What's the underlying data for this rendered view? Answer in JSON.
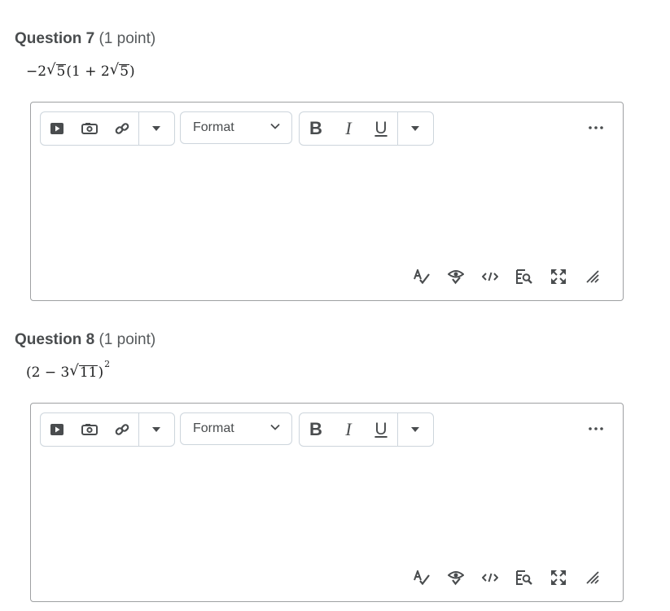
{
  "questions": [
    {
      "number_label": "Question 7",
      "points_label": "(1 point)",
      "expression": {
        "lead": "−2",
        "radicand1": "5",
        "mid": "(1 + 2",
        "radicand2": "5",
        "tail": ")"
      },
      "editor": {
        "format_label": "Format",
        "bold_label": "B",
        "italic_label": "I",
        "underline_label": "U"
      }
    },
    {
      "number_label": "Question 8",
      "points_label": "(1 point)",
      "expression": {
        "lead": "(2 − 3",
        "radicand1": "11",
        "tail": ")",
        "exponent": "2"
      },
      "editor": {
        "format_label": "Format",
        "bold_label": "B",
        "italic_label": "I",
        "underline_label": "U"
      }
    }
  ],
  "icons": {
    "toolbar": [
      "video-icon",
      "camera-icon",
      "link-icon",
      "caret-down-icon"
    ],
    "format_group_more": "caret-down-icon",
    "more": "ellipsis-icon",
    "statusbar": [
      "spellcheck-icon",
      "accessibility-check-icon",
      "source-code-icon",
      "preview-icon",
      "fullscreen-icon",
      "resize-handle-icon"
    ]
  },
  "colors": {
    "text": "#494c4e",
    "border": "#9ea0a2",
    "toolbar_border": "#cdd5dc"
  }
}
